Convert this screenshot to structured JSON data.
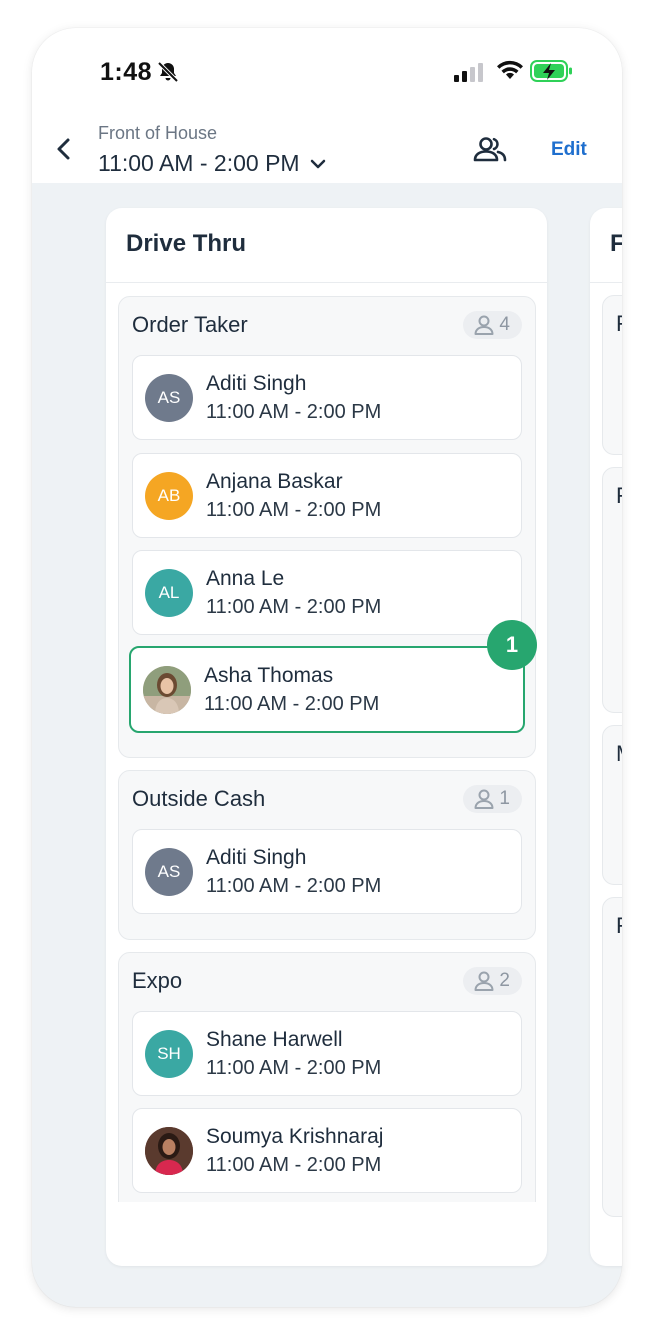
{
  "status_bar": {
    "time": "1:48"
  },
  "header": {
    "subtitle": "Front of House",
    "shift_time": "11:00 AM - 2:00 PM",
    "edit_label": "Edit"
  },
  "column": {
    "title": "Drive Thru",
    "groups": [
      {
        "title": "Order Taker",
        "count": "4",
        "employees": [
          {
            "initials": "AS",
            "name": "Aditi Singh",
            "time": "11:00 AM - 2:00 PM",
            "color": "#6f7a8c"
          },
          {
            "initials": "AB",
            "name": "Anjana Baskar",
            "time": "11:00 AM - 2:00 PM",
            "color": "#f5a623"
          },
          {
            "initials": "AL",
            "name": "Anna Le",
            "time": "11:00 AM - 2:00 PM",
            "color": "#3aa8a3"
          },
          {
            "initials": "",
            "name": "Asha Thomas",
            "time": "11:00 AM - 2:00 PM",
            "color": "#b8a795",
            "badge": "1"
          }
        ]
      },
      {
        "title": "Outside Cash",
        "count": "1",
        "employees": [
          {
            "initials": "AS",
            "name": "Aditi Singh",
            "time": "11:00 AM - 2:00 PM",
            "color": "#6f7a8c"
          }
        ]
      },
      {
        "title": "Expo",
        "count": "2",
        "employees": [
          {
            "initials": "SH",
            "name": "Shane Harwell",
            "time": "11:00 AM - 2:00 PM",
            "color": "#3aa8a3"
          },
          {
            "initials": "",
            "name": "Soumya Krishnaraj",
            "time": "11:00 AM - 2:00 PM",
            "color": "#7a3b3b"
          }
        ]
      }
    ]
  },
  "next_column": {
    "title_initial": "F",
    "group_initials": [
      "F",
      "F",
      "M",
      "F"
    ]
  },
  "icons": {
    "bell": "bell-slash-icon",
    "back": "chevron-left-icon",
    "dropdown": "chevron-down-icon",
    "people": "people-icon",
    "person": "person-icon"
  },
  "colors": {
    "accent": "#1f6fce",
    "selected": "#27a66f",
    "battery": "#2fd158"
  }
}
